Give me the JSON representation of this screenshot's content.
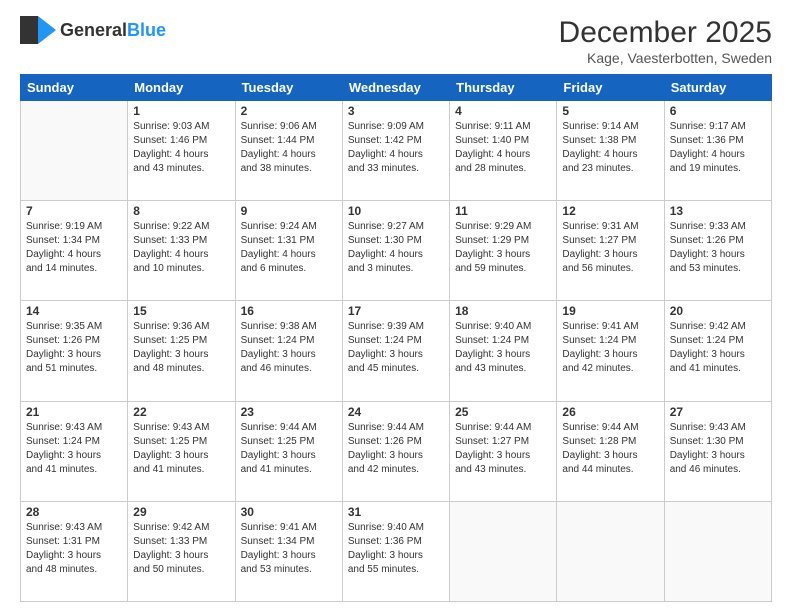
{
  "header": {
    "logo_general": "General",
    "logo_blue": "Blue",
    "month_title": "December 2025",
    "location": "Kage, Vaesterbotten, Sweden"
  },
  "days_of_week": [
    "Sunday",
    "Monday",
    "Tuesday",
    "Wednesday",
    "Thursday",
    "Friday",
    "Saturday"
  ],
  "weeks": [
    [
      {
        "day": "",
        "info": ""
      },
      {
        "day": "1",
        "info": "Sunrise: 9:03 AM\nSunset: 1:46 PM\nDaylight: 4 hours\nand 43 minutes."
      },
      {
        "day": "2",
        "info": "Sunrise: 9:06 AM\nSunset: 1:44 PM\nDaylight: 4 hours\nand 38 minutes."
      },
      {
        "day": "3",
        "info": "Sunrise: 9:09 AM\nSunset: 1:42 PM\nDaylight: 4 hours\nand 33 minutes."
      },
      {
        "day": "4",
        "info": "Sunrise: 9:11 AM\nSunset: 1:40 PM\nDaylight: 4 hours\nand 28 minutes."
      },
      {
        "day": "5",
        "info": "Sunrise: 9:14 AM\nSunset: 1:38 PM\nDaylight: 4 hours\nand 23 minutes."
      },
      {
        "day": "6",
        "info": "Sunrise: 9:17 AM\nSunset: 1:36 PM\nDaylight: 4 hours\nand 19 minutes."
      }
    ],
    [
      {
        "day": "7",
        "info": "Sunrise: 9:19 AM\nSunset: 1:34 PM\nDaylight: 4 hours\nand 14 minutes."
      },
      {
        "day": "8",
        "info": "Sunrise: 9:22 AM\nSunset: 1:33 PM\nDaylight: 4 hours\nand 10 minutes."
      },
      {
        "day": "9",
        "info": "Sunrise: 9:24 AM\nSunset: 1:31 PM\nDaylight: 4 hours\nand 6 minutes."
      },
      {
        "day": "10",
        "info": "Sunrise: 9:27 AM\nSunset: 1:30 PM\nDaylight: 4 hours\nand 3 minutes."
      },
      {
        "day": "11",
        "info": "Sunrise: 9:29 AM\nSunset: 1:29 PM\nDaylight: 3 hours\nand 59 minutes."
      },
      {
        "day": "12",
        "info": "Sunrise: 9:31 AM\nSunset: 1:27 PM\nDaylight: 3 hours\nand 56 minutes."
      },
      {
        "day": "13",
        "info": "Sunrise: 9:33 AM\nSunset: 1:26 PM\nDaylight: 3 hours\nand 53 minutes."
      }
    ],
    [
      {
        "day": "14",
        "info": "Sunrise: 9:35 AM\nSunset: 1:26 PM\nDaylight: 3 hours\nand 51 minutes."
      },
      {
        "day": "15",
        "info": "Sunrise: 9:36 AM\nSunset: 1:25 PM\nDaylight: 3 hours\nand 48 minutes."
      },
      {
        "day": "16",
        "info": "Sunrise: 9:38 AM\nSunset: 1:24 PM\nDaylight: 3 hours\nand 46 minutes."
      },
      {
        "day": "17",
        "info": "Sunrise: 9:39 AM\nSunset: 1:24 PM\nDaylight: 3 hours\nand 45 minutes."
      },
      {
        "day": "18",
        "info": "Sunrise: 9:40 AM\nSunset: 1:24 PM\nDaylight: 3 hours\nand 43 minutes."
      },
      {
        "day": "19",
        "info": "Sunrise: 9:41 AM\nSunset: 1:24 PM\nDaylight: 3 hours\nand 42 minutes."
      },
      {
        "day": "20",
        "info": "Sunrise: 9:42 AM\nSunset: 1:24 PM\nDaylight: 3 hours\nand 41 minutes."
      }
    ],
    [
      {
        "day": "21",
        "info": "Sunrise: 9:43 AM\nSunset: 1:24 PM\nDaylight: 3 hours\nand 41 minutes."
      },
      {
        "day": "22",
        "info": "Sunrise: 9:43 AM\nSunset: 1:25 PM\nDaylight: 3 hours\nand 41 minutes."
      },
      {
        "day": "23",
        "info": "Sunrise: 9:44 AM\nSunset: 1:25 PM\nDaylight: 3 hours\nand 41 minutes."
      },
      {
        "day": "24",
        "info": "Sunrise: 9:44 AM\nSunset: 1:26 PM\nDaylight: 3 hours\nand 42 minutes."
      },
      {
        "day": "25",
        "info": "Sunrise: 9:44 AM\nSunset: 1:27 PM\nDaylight: 3 hours\nand 43 minutes."
      },
      {
        "day": "26",
        "info": "Sunrise: 9:44 AM\nSunset: 1:28 PM\nDaylight: 3 hours\nand 44 minutes."
      },
      {
        "day": "27",
        "info": "Sunrise: 9:43 AM\nSunset: 1:30 PM\nDaylight: 3 hours\nand 46 minutes."
      }
    ],
    [
      {
        "day": "28",
        "info": "Sunrise: 9:43 AM\nSunset: 1:31 PM\nDaylight: 3 hours\nand 48 minutes."
      },
      {
        "day": "29",
        "info": "Sunrise: 9:42 AM\nSunset: 1:33 PM\nDaylight: 3 hours\nand 50 minutes."
      },
      {
        "day": "30",
        "info": "Sunrise: 9:41 AM\nSunset: 1:34 PM\nDaylight: 3 hours\nand 53 minutes."
      },
      {
        "day": "31",
        "info": "Sunrise: 9:40 AM\nSunset: 1:36 PM\nDaylight: 3 hours\nand 55 minutes."
      },
      {
        "day": "",
        "info": ""
      },
      {
        "day": "",
        "info": ""
      },
      {
        "day": "",
        "info": ""
      }
    ]
  ]
}
